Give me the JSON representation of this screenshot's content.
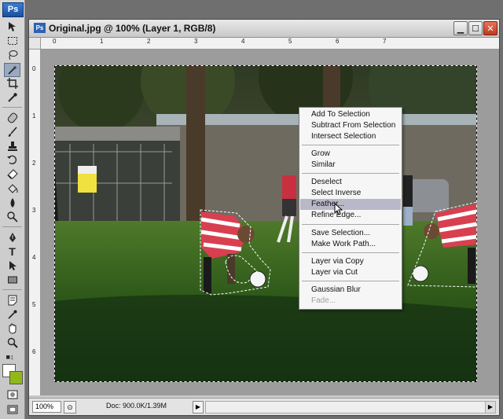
{
  "app": {
    "badge": "Ps",
    "accent": "#1a4f9e"
  },
  "toolbar": {
    "tools": [
      "move-tool",
      "marquee-tool",
      "lasso-tool",
      "magic-wand-tool",
      "crop-tool",
      "eyedropper-tool",
      "healing-brush-tool",
      "brush-tool",
      "clone-stamp-tool",
      "history-brush-tool",
      "eraser-tool",
      "paint-bucket-tool",
      "blur-tool",
      "dodge-tool",
      "pen-tool",
      "type-tool",
      "path-selection-tool",
      "shape-tool",
      "notes-tool",
      "eyedropper-tool-2",
      "hand-tool",
      "zoom-tool"
    ],
    "active_tool": "magic-wand-tool",
    "type_glyph": "T",
    "foreground_color": "#ffffff",
    "background_color": "#8fb818"
  },
  "document": {
    "title": "Original.jpg @ 100% (Layer 1, RGB/8)",
    "icon_label": "Ps",
    "window_buttons": {
      "minimize": "▁",
      "maximize": "☐",
      "close": "✕"
    },
    "ruler_top_labels": [
      "0",
      "1",
      "2",
      "3",
      "4",
      "5",
      "6",
      "7"
    ],
    "ruler_left_labels": [
      "0",
      "1",
      "2",
      "3",
      "4",
      "5",
      "6"
    ],
    "zoom": "100%",
    "doc_info": "Doc: 900.0K/1.39M",
    "status_arrow": "▶",
    "scroll_right": "▶"
  },
  "context_menu": {
    "groups": [
      [
        "Add To Selection",
        "Subtract From Selection",
        "Intersect Selection"
      ],
      [
        "Grow",
        "Similar"
      ],
      [
        "Deselect",
        "Select Inverse",
        "Feather...",
        "Refine Edge..."
      ],
      [
        "Save Selection...",
        "Make Work Path..."
      ],
      [
        "Layer via Copy",
        "Layer via Cut"
      ],
      [
        "Gaussian Blur",
        "Fade..."
      ]
    ],
    "highlighted": "Feather...",
    "disabled": [
      "Fade..."
    ]
  }
}
